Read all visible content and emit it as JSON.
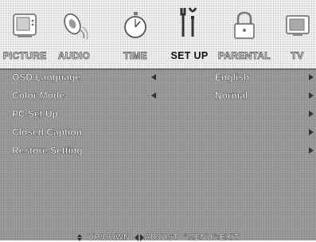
{
  "tabs": [
    {
      "label": "PICTURE",
      "icon": "tv-icon",
      "active": false
    },
    {
      "label": "AUDIO",
      "icon": "speaker-icon",
      "active": false
    },
    {
      "label": "TIME",
      "icon": "stopwatch-icon",
      "active": false
    },
    {
      "label": "SET UP",
      "icon": "tools-icon",
      "active": true
    },
    {
      "label": "PARENTAL",
      "icon": "padlock-icon",
      "active": false
    },
    {
      "label": "TV",
      "icon": "tv-screen-icon",
      "active": false
    }
  ],
  "menu": {
    "items": [
      {
        "label": "OSD Language",
        "value": "English",
        "left_arrow": true
      },
      {
        "label": "Color Mode",
        "value": "Normal",
        "left_arrow": true
      },
      {
        "label": "PC Set Up",
        "value": "",
        "left_arrow": false
      },
      {
        "label": "Closed Caption",
        "value": "",
        "left_arrow": false
      },
      {
        "label": "Restore Setting",
        "value": "",
        "left_arrow": false
      }
    ]
  },
  "footer": {
    "updown": "UP/DOWN",
    "adjust": "ADJUST",
    "exit": "\"MENU\":EXIT"
  },
  "colors": {
    "panel_bg": "#9c9c9c",
    "topbar_bg": "#f2f2f2",
    "text": "#ffffff"
  }
}
